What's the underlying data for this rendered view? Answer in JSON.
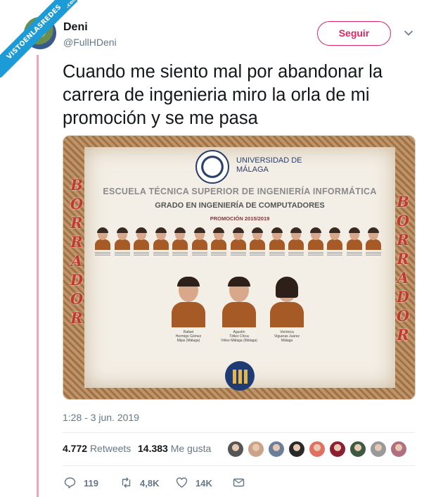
{
  "watermark": {
    "text": "VISTOENLASREDES",
    "suffix": ".com",
    "color": "#1d9bd7"
  },
  "author": {
    "name": "Deni",
    "handle": "@FullHDeni",
    "avatar": "cartoon-avatar"
  },
  "follow_button": {
    "label": "Seguir",
    "color": "#e0245e"
  },
  "tweet": {
    "text": "Cuando me siento mal por abandonar la carrera de ingenieria miro la orla de mi promoción y se me pasa"
  },
  "media": {
    "university": "UNIVERSIDAD DE MÁLAGA",
    "school": "ESCUELA TÉCNICA SUPERIOR  DE INGENIERÍA INFORMÁTICA",
    "degree": "GRADO EN INGENIERÍA DE COMPUTADORES",
    "promotion": "PROMOCIÓN 2015/2019",
    "stamp_left": "BORRADOR",
    "stamp_right": "BORRADOR",
    "stamp_color": "#c4392d",
    "students": [
      {
        "name": "Rafael",
        "detail": "Hermigo Gómez",
        "place": "Mijas (Málaga)"
      },
      {
        "name": "Agustín",
        "detail": "Téllez Chica",
        "place": "Vélez-Málaga (Málaga)"
      },
      {
        "name": "Verónica",
        "detail": "Vigueras Juárez",
        "place": "Málaga"
      }
    ]
  },
  "timestamp": "1:28 - 3 jun. 2019",
  "stats": {
    "retweets_count": "4.772",
    "retweets_label": "Retweets",
    "likes_count": "14.383",
    "likes_label": "Me gusta"
  },
  "actions": {
    "replies": "119",
    "retweets": "4,8K",
    "likes": "14K"
  },
  "colors": {
    "text": "#14171a",
    "secondary": "#657786",
    "divider": "#e6ecf0",
    "thread_line": "#e8a7b8"
  }
}
